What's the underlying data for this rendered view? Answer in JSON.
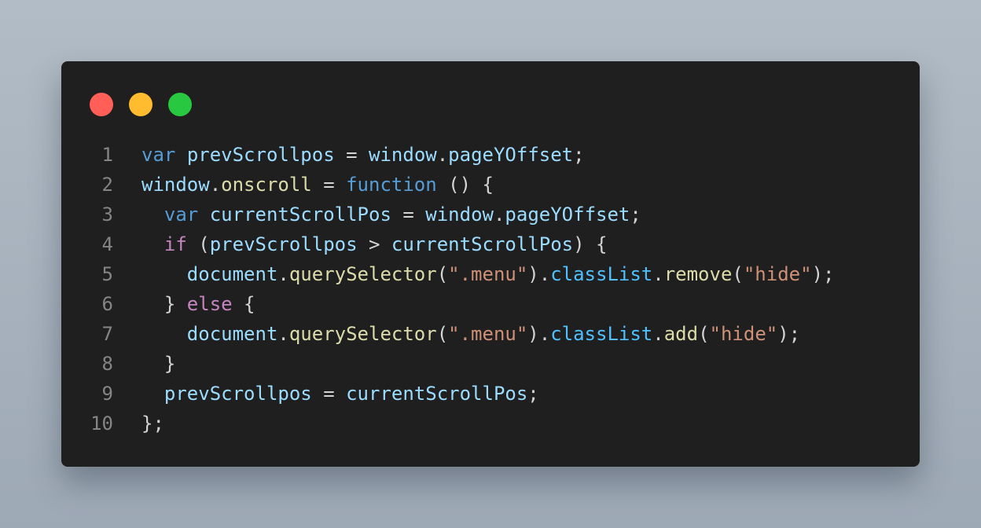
{
  "colors": {
    "page_background_top": "#b2bcc6",
    "page_background_bottom": "#9ea9b6",
    "editor_background": "#1f1f1f",
    "line_number": "#858585",
    "close_button": "#ff5f57",
    "minimize_button": "#febc2e",
    "maximize_button": "#28c840"
  },
  "token_colors": {
    "keyword": "#569cd6",
    "control": "#c586c0",
    "variable": "#9cdcfe",
    "method": "#dcdcaa",
    "string": "#ce9178",
    "punctuation": "#d4d4d4",
    "object_property": "#4fc1ff"
  },
  "window_controls": [
    {
      "name": "close",
      "color": "#ff5f57"
    },
    {
      "name": "minimize",
      "color": "#febc2e"
    },
    {
      "name": "maximize",
      "color": "#28c840"
    }
  ],
  "code": {
    "lines": [
      {
        "number": "1",
        "tokens": [
          {
            "t": "var",
            "k": "keyword"
          },
          {
            "t": " ",
            "k": "punctuation"
          },
          {
            "t": "prevScrollpos",
            "k": "variable"
          },
          {
            "t": " = ",
            "k": "punctuation"
          },
          {
            "t": "window",
            "k": "variable"
          },
          {
            "t": ".",
            "k": "punctuation"
          },
          {
            "t": "pageYOffset",
            "k": "variable"
          },
          {
            "t": ";",
            "k": "punctuation"
          }
        ]
      },
      {
        "number": "2",
        "tokens": [
          {
            "t": "window",
            "k": "variable"
          },
          {
            "t": ".",
            "k": "punctuation"
          },
          {
            "t": "onscroll",
            "k": "method"
          },
          {
            "t": " = ",
            "k": "punctuation"
          },
          {
            "t": "function",
            "k": "keyword"
          },
          {
            "t": " () {",
            "k": "punctuation"
          }
        ]
      },
      {
        "number": "3",
        "tokens": [
          {
            "t": "  ",
            "k": "punctuation"
          },
          {
            "t": "var",
            "k": "keyword"
          },
          {
            "t": " ",
            "k": "punctuation"
          },
          {
            "t": "currentScrollPos",
            "k": "variable"
          },
          {
            "t": " = ",
            "k": "punctuation"
          },
          {
            "t": "window",
            "k": "variable"
          },
          {
            "t": ".",
            "k": "punctuation"
          },
          {
            "t": "pageYOffset",
            "k": "variable"
          },
          {
            "t": ";",
            "k": "punctuation"
          }
        ]
      },
      {
        "number": "4",
        "tokens": [
          {
            "t": "  ",
            "k": "punctuation"
          },
          {
            "t": "if",
            "k": "control"
          },
          {
            "t": " (",
            "k": "punctuation"
          },
          {
            "t": "prevScrollpos",
            "k": "variable"
          },
          {
            "t": " > ",
            "k": "punctuation"
          },
          {
            "t": "currentScrollPos",
            "k": "variable"
          },
          {
            "t": ") {",
            "k": "punctuation"
          }
        ]
      },
      {
        "number": "5",
        "tokens": [
          {
            "t": "    ",
            "k": "punctuation"
          },
          {
            "t": "document",
            "k": "variable"
          },
          {
            "t": ".",
            "k": "punctuation"
          },
          {
            "t": "querySelector",
            "k": "method"
          },
          {
            "t": "(",
            "k": "punctuation"
          },
          {
            "t": "\".menu\"",
            "k": "string"
          },
          {
            "t": ").",
            "k": "punctuation"
          },
          {
            "t": "classList",
            "k": "object_property"
          },
          {
            "t": ".",
            "k": "punctuation"
          },
          {
            "t": "remove",
            "k": "method"
          },
          {
            "t": "(",
            "k": "punctuation"
          },
          {
            "t": "\"hide\"",
            "k": "string"
          },
          {
            "t": ");",
            "k": "punctuation"
          }
        ]
      },
      {
        "number": "6",
        "tokens": [
          {
            "t": "  } ",
            "k": "punctuation"
          },
          {
            "t": "else",
            "k": "control"
          },
          {
            "t": " {",
            "k": "punctuation"
          }
        ]
      },
      {
        "number": "7",
        "tokens": [
          {
            "t": "    ",
            "k": "punctuation"
          },
          {
            "t": "document",
            "k": "variable"
          },
          {
            "t": ".",
            "k": "punctuation"
          },
          {
            "t": "querySelector",
            "k": "method"
          },
          {
            "t": "(",
            "k": "punctuation"
          },
          {
            "t": "\".menu\"",
            "k": "string"
          },
          {
            "t": ").",
            "k": "punctuation"
          },
          {
            "t": "classList",
            "k": "object_property"
          },
          {
            "t": ".",
            "k": "punctuation"
          },
          {
            "t": "add",
            "k": "method"
          },
          {
            "t": "(",
            "k": "punctuation"
          },
          {
            "t": "\"hide\"",
            "k": "string"
          },
          {
            "t": ");",
            "k": "punctuation"
          }
        ]
      },
      {
        "number": "8",
        "tokens": [
          {
            "t": "  }",
            "k": "punctuation"
          }
        ]
      },
      {
        "number": "9",
        "tokens": [
          {
            "t": "  ",
            "k": "punctuation"
          },
          {
            "t": "prevScrollpos",
            "k": "variable"
          },
          {
            "t": " = ",
            "k": "punctuation"
          },
          {
            "t": "currentScrollPos",
            "k": "variable"
          },
          {
            "t": ";",
            "k": "punctuation"
          }
        ]
      },
      {
        "number": "10",
        "tokens": [
          {
            "t": "};",
            "k": "punctuation"
          }
        ]
      }
    ]
  }
}
